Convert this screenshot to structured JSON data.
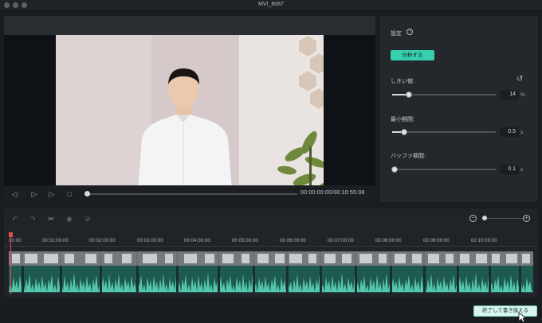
{
  "window": {
    "title": "MVI_8087"
  },
  "player": {
    "timecode": "00:00:00:00/00:10:55:08"
  },
  "settings": {
    "title": "設定",
    "analyze_label": "分析する",
    "threshold": {
      "label": "しきい値:",
      "value": "14",
      "unit": "%",
      "level": 0.14
    },
    "min_gap": {
      "label": "最小期間:",
      "value": "0.5",
      "unit": "s",
      "level": 0.1
    },
    "buffer": {
      "label": "バッファ期間:",
      "value": "0.1",
      "unit": "s",
      "level": 0.02
    }
  },
  "timeline": {
    "ruler_labels": [
      "00:00",
      "00:01:00:00",
      "00:02:00:00",
      "00:03:00:00",
      "00:04:00:00",
      "00:05:00:00",
      "00:06:00:00",
      "00:07:00:00",
      "00:08:00:00",
      "00:09:00:00",
      "00:10:00:00"
    ]
  },
  "footer": {
    "finish_label": "終了して書き換える"
  },
  "icons": [
    "help-icon",
    "reset-icon",
    "step-back-icon",
    "play-icon",
    "play-next-icon",
    "stop-icon",
    "undo-icon",
    "redo-icon",
    "scissors-icon",
    "eye-icon",
    "hide-icon",
    "zoom-out-icon",
    "zoom-in-icon",
    "cursor-icon"
  ],
  "colors": {
    "accent": "#35cfae",
    "audio": "#1f5c52",
    "waveform": "#5fd9bd",
    "playhead": "#e04b4b"
  }
}
